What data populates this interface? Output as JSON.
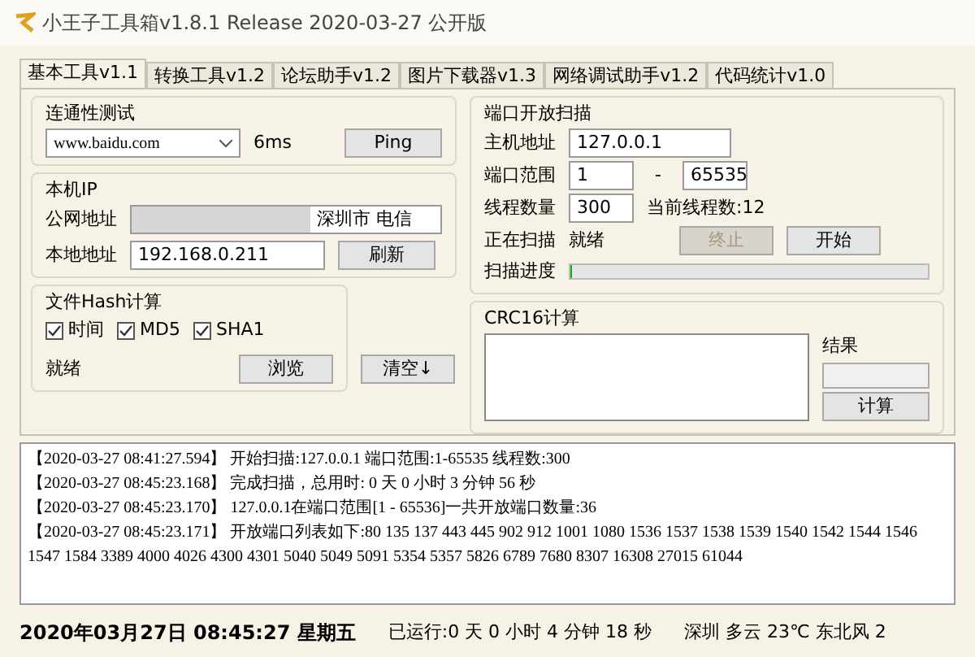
{
  "window": {
    "title": "小王子工具箱v1.8.1 Release 2020-03-27 公开版"
  },
  "tabs": [
    {
      "label": "基本工具v1.1",
      "selected": true
    },
    {
      "label": "转换工具v1.2",
      "selected": false
    },
    {
      "label": "论坛助手v1.2",
      "selected": false
    },
    {
      "label": "图片下载器v1.3",
      "selected": false
    },
    {
      "label": "网络调试助手v1.2",
      "selected": false
    },
    {
      "label": "代码统计v1.0",
      "selected": false
    }
  ],
  "connectivity": {
    "title": "连通性测试",
    "host": "www.baidu.com",
    "latency": "6ms",
    "button": "Ping"
  },
  "local_ip": {
    "title": "本机IP",
    "public_label": "公网地址",
    "public_value": "深圳市 电信",
    "local_label": "本地地址",
    "local_value": "192.168.0.211",
    "button": "刷新"
  },
  "hash": {
    "title": "文件Hash计算",
    "options": [
      {
        "label": "时间",
        "checked": true
      },
      {
        "label": "MD5",
        "checked": true
      },
      {
        "label": "SHA1",
        "checked": true
      }
    ],
    "status": "就绪",
    "browse_button": "浏览",
    "clear_button": "清空↓"
  },
  "port_scan": {
    "title": "端口开放扫描",
    "host_label": "主机地址",
    "host_value": "127.0.0.1",
    "range_label": "端口范围",
    "range_from": "1",
    "range_dash": "-",
    "range_to": "65535",
    "threads_label": "线程数量",
    "threads_value": "300",
    "current_threads": "当前线程数:12",
    "scanning_label": "正在扫描",
    "scanning_status": "就绪",
    "stop_button": {
      "label": "终止",
      "disabled": true
    },
    "start_button": {
      "label": "开始",
      "disabled": false
    },
    "progress_label": "扫描进度",
    "progress": {
      "level": 0
    }
  },
  "crc16": {
    "title": "CRC16计算",
    "result_label": "结果",
    "button": "计算"
  },
  "log": [
    "【2020-03-27 08:41:27.594】 开始扫描:127.0.0.1 端口范围:1-65535 线程数:300",
    "【2020-03-27 08:45:23.168】 完成扫描，总用时: 0 天 0 小时 3 分钟 56 秒",
    "【2020-03-27 08:45:23.170】 127.0.0.1在端口范围[1 - 65536]一共开放端口数量:36",
    "【2020-03-27 08:45:23.171】 开放端口列表如下:80 135 137 443 445 902 912 1001 1080 1536 1537 1538 1539 1540 1542 1544 1546 1547 1584 3389 4000 4026 4300 4301 5040 5049 5091 5354 5357 5826 6789 7680 8307 16308 27015 61044"
  ],
  "status_bar": {
    "datetime": "2020年03月27日 08:45:27 星期五",
    "uptime": "已运行:0 天 0 小时 4 分钟 18 秒",
    "weather": "深圳 多云 23℃ 东北风 2"
  }
}
